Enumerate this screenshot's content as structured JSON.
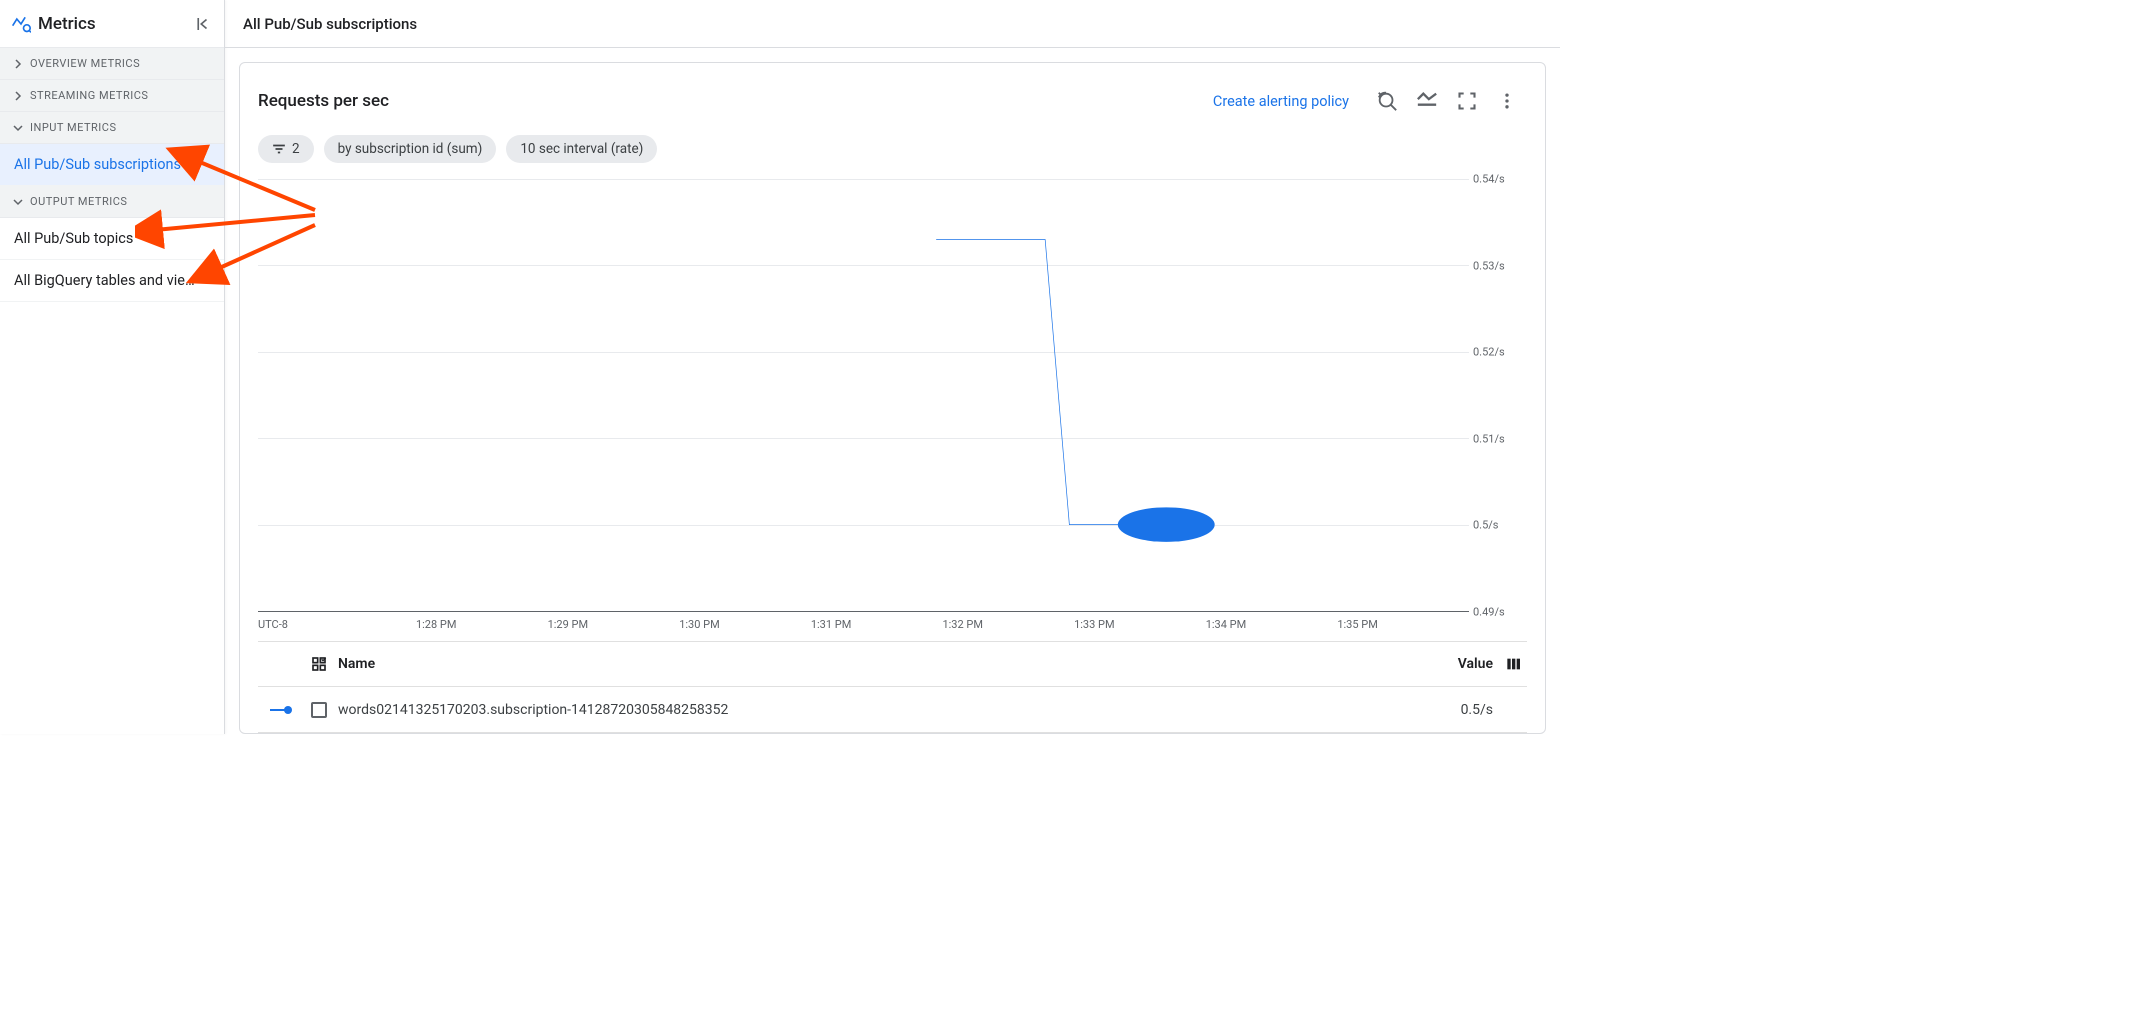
{
  "sidebar": {
    "title": "Metrics",
    "sections": [
      {
        "label": "OVERVIEW METRICS",
        "expanded": false,
        "items": []
      },
      {
        "label": "STREAMING METRICS",
        "expanded": false,
        "items": []
      },
      {
        "label": "INPUT METRICS",
        "expanded": true,
        "items": [
          {
            "label": "All Pub/Sub subscriptions",
            "selected": true
          }
        ]
      },
      {
        "label": "OUTPUT METRICS",
        "expanded": true,
        "items": [
          {
            "label": "All Pub/Sub topics",
            "selected": false
          },
          {
            "label": "All BigQuery tables and vie…",
            "selected": false
          }
        ]
      }
    ]
  },
  "header": {
    "title": "All Pub/Sub subscriptions"
  },
  "card": {
    "title": "Requests per sec",
    "alert_link": "Create alerting policy",
    "chips": {
      "filter_count": "2",
      "group": "by subscription id (sum)",
      "interval": "10 sec interval (rate)"
    }
  },
  "table": {
    "head_name": "Name",
    "head_value": "Value",
    "rows": [
      {
        "name": "words02141325170203.subscription-14128720305848258352",
        "value": "0.5/s"
      }
    ]
  },
  "chart_data": {
    "type": "line",
    "title": "Requests per sec",
    "xlabel": "UTC-8",
    "ylabel": "",
    "ylim": [
      0.49,
      0.54
    ],
    "y_ticks": [
      "0.54/s",
      "0.53/s",
      "0.52/s",
      "0.51/s",
      "0.5/s",
      "0.49/s"
    ],
    "x_ticks": [
      "UTC-8",
      "1:28 PM",
      "1:29 PM",
      "1:30 PM",
      "1:31 PM",
      "1:32 PM",
      "1:33 PM",
      "1:34 PM",
      "1:35 PM"
    ],
    "series": [
      {
        "name": "words02141325170203.subscription-14128720305848258352",
        "color": "#1a73e8",
        "x": [
          "1:31:30 PM",
          "1:32:00 PM",
          "1:32:10 PM",
          "1:33:00 PM"
        ],
        "y": [
          0.533,
          0.533,
          0.5,
          0.5
        ]
      }
    ]
  }
}
